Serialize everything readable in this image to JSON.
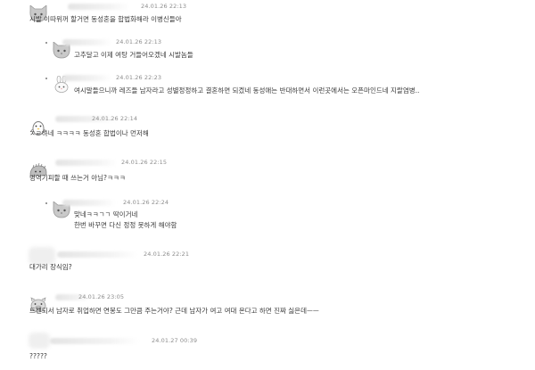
{
  "comments": [
    {
      "avatar": "gray-cat-icon",
      "date": "24.01.26 22:13",
      "lines": [
        "시발 이따위꺼 할거면 동성혼을 합법화해라 이병신들아"
      ]
    },
    {
      "avatar": "gray-cat-icon",
      "date": "24.01.26 22:13",
      "lines": [
        "고추달고 이제 여탕 거들어오겠네 시발놈들"
      ],
      "reply": true
    },
    {
      "avatar": "rabbit-icon",
      "date": "24.01.26 22:23",
      "lines": [
        "여시말들으니까 레즈들 남자라고 성별정정하고 결혼하면 되겠네 동성애는 반대하면서 이런곳에서는 오픈마인드네 지랄염병.."
      ],
      "reply": true
    },
    {
      "avatar": "penguin-icon",
      "date": "24.01.26 22:14",
      "lines": [
        "ㅈㄹ하네 ㅋㅋㅋㅋ 동성혼 합법이나 먼저해"
      ]
    },
    {
      "avatar": "hedgehog-icon",
      "date": "24.01.26 22:15",
      "lines": [
        "병역기피할 때 쓰는거 아님?ㅋㅋㅋ"
      ]
    },
    {
      "avatar": "gray-cat-icon",
      "date": "24.01.26 22:24",
      "lines": [
        "맞네ㅋㅋㄱㄱ 딱이거네",
        "한번 바꾸면 다신 정정 못하게 해야함"
      ],
      "reply": true
    },
    {
      "avatar": "blank",
      "date": "24.01.26 22:21",
      "lines": [
        "대가리 장식임?"
      ]
    },
    {
      "avatar": "pig-icon",
      "date": "24.01.26 23:05",
      "lines": [
        "트젠되서 남자로 취업하면 연봉도 그만큼 주는거야? 근데 남자가 여고 여대 온다고 하면 진짜 싫은데ㅡㅡ"
      ]
    },
    {
      "avatar": "blank",
      "date": "24.01.27 00:39",
      "lines": [
        "?????"
      ]
    }
  ]
}
